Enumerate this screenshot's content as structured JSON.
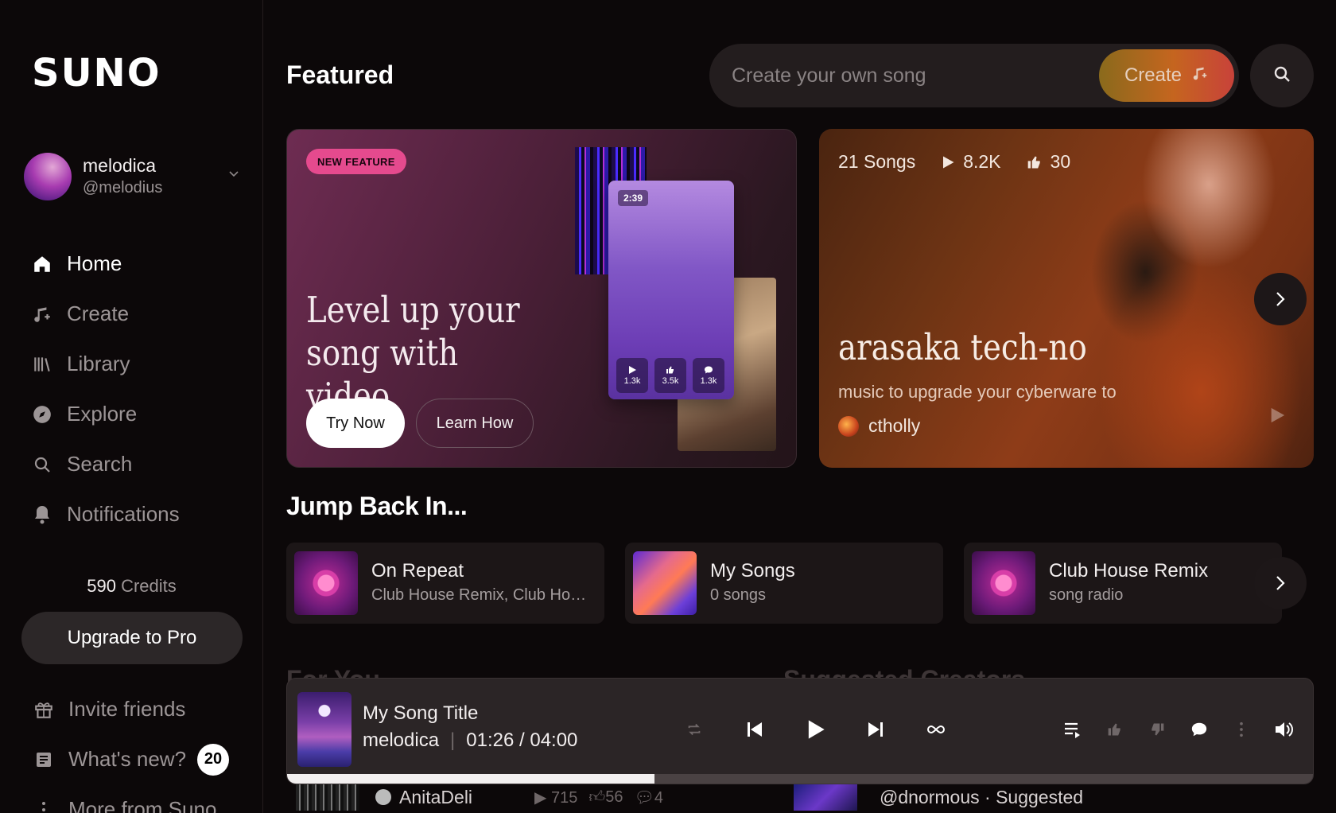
{
  "sidebar": {
    "logo": "SUNO",
    "user": {
      "name": "melodica",
      "handle": "@melodius"
    },
    "nav": [
      {
        "label": "Home",
        "icon": "home-icon"
      },
      {
        "label": "Create",
        "icon": "music-plus-icon"
      },
      {
        "label": "Library",
        "icon": "library-icon"
      },
      {
        "label": "Explore",
        "icon": "compass-icon"
      },
      {
        "label": "Search",
        "icon": "search-icon"
      },
      {
        "label": "Notifications",
        "icon": "bell-icon"
      }
    ],
    "credits": {
      "amount": "590",
      "label": "Credits"
    },
    "upgrade_label": "Upgrade to Pro",
    "bottom": [
      {
        "label": "Invite friends",
        "icon": "gift-icon"
      },
      {
        "label": "What's new?",
        "icon": "news-icon",
        "badge": "20"
      },
      {
        "label": "More from Suno",
        "icon": "more-vertical-icon"
      }
    ]
  },
  "header": {
    "title": "Featured",
    "search_placeholder": "Create your own song",
    "create_label": "Create"
  },
  "banner_video": {
    "pill": "NEW FEATURE",
    "title": "Level up your song with video",
    "try_label": "Try Now",
    "learn_label": "Learn How",
    "phone_time": "2:39",
    "phone_stats": [
      "1.3k",
      "3.5k",
      "1.3k"
    ]
  },
  "banner_playlist": {
    "songs": "21 Songs",
    "plays": "8.2K",
    "likes": "30",
    "title": "arasaka tech-no",
    "subtitle": "music to upgrade your cyberware to",
    "author": "ctholly"
  },
  "jump_back": {
    "title": "Jump Back In...",
    "items": [
      {
        "title": "On Repeat",
        "subtitle": "Club House Remix, Club Hous..."
      },
      {
        "title": "My Songs",
        "subtitle": "0 songs"
      },
      {
        "title": "Club House Remix",
        "subtitle": "song radio"
      }
    ]
  },
  "ghost_headers": [
    "For You",
    "Suggested Creators"
  ],
  "player": {
    "title": "My Song Title",
    "artist": "melodica",
    "time": "01:26 / 04:00",
    "progress": 0.358
  },
  "peek_row": {
    "left": {
      "author": "AnitaDeli",
      "plays": "715",
      "likes": "56",
      "comments": "4"
    },
    "right": {
      "text": "@dnormous · Suggested"
    }
  },
  "colors": {
    "background": "#0c0809",
    "accent_badge": "#e54a8e",
    "player_bg": "#2b2526"
  }
}
